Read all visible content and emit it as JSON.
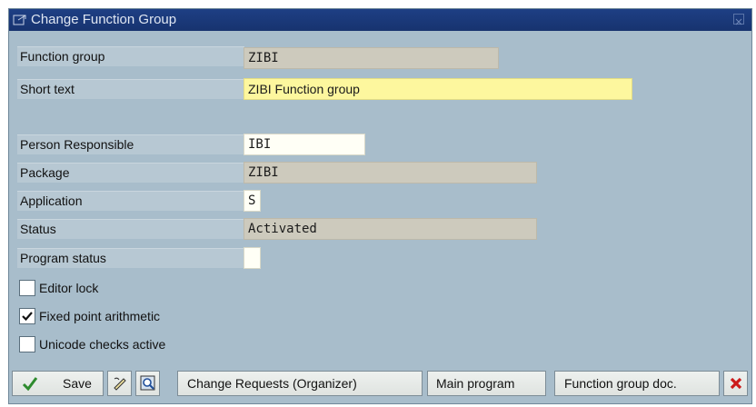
{
  "window": {
    "title": "Change Function Group"
  },
  "fields": {
    "function_group": {
      "label": "Function group",
      "value": "ZIBI"
    },
    "short_text": {
      "label": "Short text",
      "value": "ZIBI Function group"
    },
    "person_responsible": {
      "label": "Person Responsible",
      "value": "IBI"
    },
    "package": {
      "label": "Package",
      "value": "ZIBI"
    },
    "application": {
      "label": "Application",
      "value": "S"
    },
    "status": {
      "label": "Status",
      "value": "Activated"
    },
    "program_status": {
      "label": "Program status",
      "value": ""
    }
  },
  "checkboxes": {
    "editor_lock": {
      "label": "Editor lock",
      "checked": false
    },
    "fixed_point": {
      "label": "Fixed point arithmetic",
      "checked": true
    },
    "unicode_checks": {
      "label": "Unicode checks active",
      "checked": false
    }
  },
  "toolbar": {
    "save_label": "Save",
    "change_requests_label": "Change Requests (Organizer)",
    "main_program_label": "Main program",
    "function_group_doc_label": "Function group doc."
  },
  "icons": {
    "save": "checkmark-icon",
    "pencil": "edit-icon",
    "find": "find-icon",
    "cancel": "cancel-icon",
    "window": "window-icon",
    "close": "close-icon"
  },
  "colors": {
    "titlebar": "#1e3f84",
    "background": "#a8bdcb",
    "required_field": "#fdf79e",
    "readonly_field": "#cdcabd",
    "cancel_red": "#cc1a1a",
    "checkmark_green": "#2e8b2e"
  }
}
